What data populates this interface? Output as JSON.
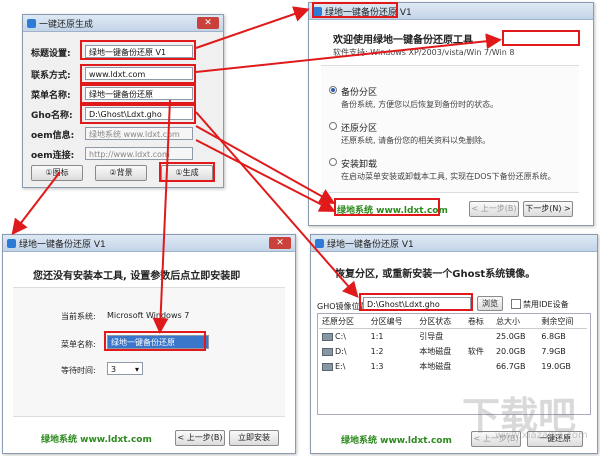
{
  "generator": {
    "title": "一键还原生成",
    "fields": [
      {
        "label": "标题设置:",
        "value": "绿地一键备份还原 V1",
        "gray": false
      },
      {
        "label": "联系方式:",
        "value": "www.ldxt.com",
        "gray": false
      },
      {
        "label": "菜单名称:",
        "value": "绿地一键备份还原",
        "gray": false
      },
      {
        "label": "Gho名称:",
        "value": "D:\\Ghost\\Ldxt.gho",
        "gray": false
      },
      {
        "label": "oem信息:",
        "value": "绿地系统 www.ldxt.com",
        "gray": true
      },
      {
        "label": "oem连接:",
        "value": "http://www.ldxt.com",
        "gray": true
      }
    ],
    "buttons": {
      "icon": "①图标",
      "background": "②背景",
      "generate": "①生成"
    }
  },
  "main": {
    "title": "绿地一键备份还原 V1",
    "heading": "欢迎使用绿地一键备份还原工具",
    "supported": "软件支持: Windows XP/2003/vista/Win 7/Win 8",
    "options": [
      {
        "name": "备份分区",
        "desc": "备份系统, 方便您以后恢复到备份时的状态。",
        "selected": true
      },
      {
        "name": "还原分区",
        "desc": "还原系统, 请备份您的相关资料以免删除。",
        "selected": false
      },
      {
        "name": "安装卸载",
        "desc": "在启动菜单安装或卸载本工具, 实现在DOS下备份还原系统。",
        "selected": false
      }
    ],
    "oem": "绿地系统 www.ldxt.com",
    "prev": "< 上一步(B)",
    "next": "下一步(N) >"
  },
  "install": {
    "title": "绿地一键备份还原 V1",
    "heading": "您还没有安装本工具, 设置参数后点立即安装即",
    "current_system_label": "当前系统:",
    "current_system_value": "Microsoft Windows 7",
    "menu_name_label": "菜单名称:",
    "menu_name_value": "绿地一键备份还原",
    "wait_label": "等待时间:",
    "wait_value": "3",
    "oem": "绿地系统 www.ldxt.com",
    "prev": "< 上一步(B)",
    "install_btn": "立即安装"
  },
  "restore": {
    "title": "绿地一键备份还原 V1",
    "heading": "恢复分区, 或重新安装一个Ghost系统镜像。",
    "gho_label": "GHO镜像位置",
    "gho_value": "D:\\Ghost\\Ldxt.gho",
    "browse": "浏览",
    "disable_ide": "禁用IDE设备",
    "columns": [
      "还原分区",
      "分区编号",
      "分区状态",
      "卷标",
      "总大小",
      "剩余空间"
    ],
    "rows": [
      {
        "drive": "C:\\",
        "num": "1:1",
        "status": "引导盘",
        "label": "",
        "total": "25.0GB",
        "free": "6.8GB"
      },
      {
        "drive": "D:\\",
        "num": "1:2",
        "status": "本地磁盘",
        "label": "软件",
        "total": "20.0GB",
        "free": "7.9GB"
      },
      {
        "drive": "E:\\",
        "num": "1:3",
        "status": "本地磁盘",
        "label": "",
        "total": "66.7GB",
        "free": "19.0GB"
      }
    ],
    "oem": "绿地系统 www.ldxt.com",
    "prev": "< 上一步(B)",
    "restore_btn": "一键还原"
  },
  "colors": {
    "accent_red": "#e01a1a",
    "oem_green": "#2d8a1f"
  },
  "watermark": {
    "text": "下载吧",
    "sub": "www.xiazaiba.com"
  }
}
